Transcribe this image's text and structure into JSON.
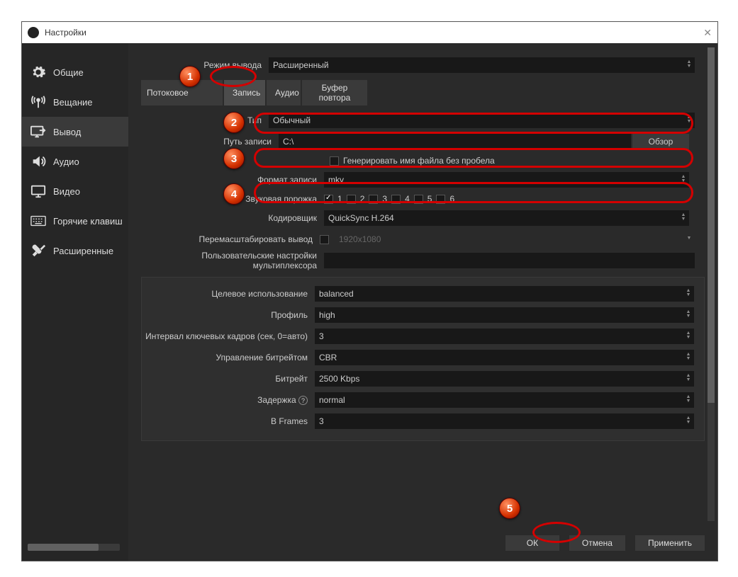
{
  "window": {
    "title": "Настройки"
  },
  "sidebar": {
    "items": [
      {
        "label": "Общие"
      },
      {
        "label": "Вещание"
      },
      {
        "label": "Вывод"
      },
      {
        "label": "Аудио"
      },
      {
        "label": "Видео"
      },
      {
        "label": "Горячие клавиш"
      },
      {
        "label": "Расширенные"
      }
    ]
  },
  "outputMode": {
    "label": "Режим вывода",
    "value": "Расширенный"
  },
  "tabs": {
    "items": [
      {
        "label": "Потоковое"
      },
      {
        "label": "Запись"
      },
      {
        "label": "Аудио"
      },
      {
        "label": "Буфер повтора"
      }
    ]
  },
  "record": {
    "type_label": "Тип",
    "type_value": "Обычный",
    "path_label": "Путь записи",
    "path_value": "C:\\",
    "browse": "Обзор",
    "nospace_label": "Генерировать имя файла без пробела",
    "format_label": "Формат записи",
    "format_value": "mkv",
    "tracks_label": "Звуковая порожка",
    "tracks": [
      "1",
      "2",
      "3",
      "4",
      "5",
      "6"
    ],
    "encoder_label": "Кодировщик",
    "encoder_value": "QuickSync H.264",
    "rescale_label": "Перемасштабировать вывод",
    "rescale_value": "1920x1080",
    "mux_label": "Пользовательские настройки мультиплексора"
  },
  "encoder": {
    "target_label": "Целевое использование",
    "target_value": "balanced",
    "profile_label": "Профиль",
    "profile_value": "high",
    "keyint_label": "Интервал ключевых кадров (сек, 0=авто)",
    "keyint_value": "3",
    "ratectl_label": "Управление битрейтом",
    "ratectl_value": "CBR",
    "bitrate_label": "Битрейт",
    "bitrate_value": "2500 Kbps",
    "latency_label": "Задержка",
    "latency_value": "normal",
    "bframes_label": "B Frames",
    "bframes_value": "3"
  },
  "buttons": {
    "ok": "ОК",
    "cancel": "Отмена",
    "apply": "Применить"
  },
  "markers": [
    "1",
    "2",
    "3",
    "4",
    "5"
  ]
}
